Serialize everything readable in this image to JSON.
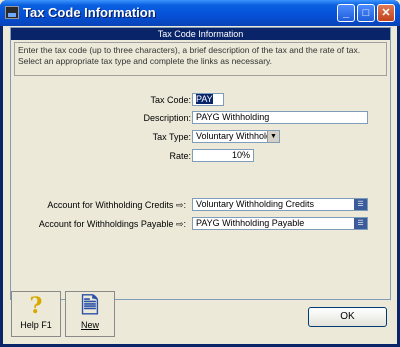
{
  "window": {
    "title": "Tax Code Information"
  },
  "panel": {
    "header": "Tax Code Information",
    "intro_line1": "Enter the tax code (up to three characters), a brief description of the tax and the rate of tax.",
    "intro_line2": "Select an appropriate tax type and complete the links as necessary."
  },
  "form": {
    "tax_code_label": "Tax Code:",
    "tax_code_value": "PAY",
    "description_label": "Description:",
    "description_value": "PAYG Withholding",
    "tax_type_label": "Tax Type:",
    "tax_type_value": "Voluntary Withholdings",
    "rate_label": "Rate:",
    "rate_value": "10%",
    "credits_label": "Account for Withholding Credits",
    "credits_value": "Voluntary Withholding Credits",
    "payable_label": "Account for Withholdings Payable",
    "payable_value": "PAYG Withholding Payable"
  },
  "toolbar": {
    "help_label": "Help F1",
    "new_label": "New"
  },
  "buttons": {
    "ok_label": "OK"
  },
  "colors": {
    "titlebar": "#0550D6",
    "panel_header": "#0A246A",
    "background": "#ECE9D8"
  },
  "icons": {
    "help": "question-mark-icon",
    "new": "new-document-icon",
    "link_arrow": "arrow-right-icon"
  }
}
